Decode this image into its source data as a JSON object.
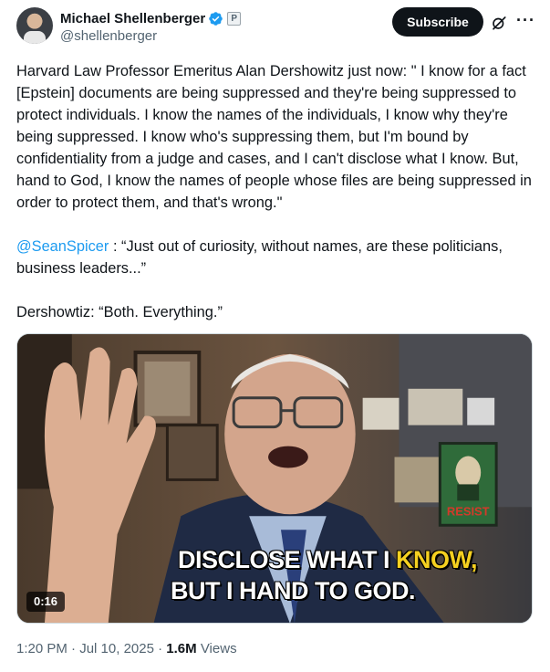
{
  "author": {
    "name": "Michael Shellenberger",
    "handle": "@shellenberger",
    "badge_letter": "P"
  },
  "actions": {
    "subscribe_label": "Subscribe"
  },
  "tweet": {
    "paragraph1": "Harvard Law Professor Emeritus Alan Dershowitz just now: \" I know for a fact [Epstein] documents are being suppressed and they're being suppressed to protect individuals. I know the names of the individuals, I know why they're being suppressed. I know who's suppressing them, but I'm bound by confidentiality from a judge and cases, and I can't disclose what I know. But, hand to God, I know the names of people whose files are being suppressed in order to protect them, and that's wrong.\"",
    "mention": "@SeanSpicer",
    "paragraph2_rest": " : “Just out of curiosity, without names, are these politicians, business leaders...”",
    "paragraph3": "Dershowtiz: “Both. Everything.”"
  },
  "media": {
    "caption_line1_a": "DISCLOSE WHAT I ",
    "caption_line1_b": "KNOW,",
    "caption_line2": "BUT I HAND TO GOD.",
    "duration": "0:16",
    "poster_text": "RESIST"
  },
  "meta": {
    "time": "1:20 PM",
    "sep1": " · ",
    "date": "Jul 10, 2025",
    "sep2": " · ",
    "views": "1.6M",
    "views_label": " Views"
  },
  "colors": {
    "accent": "#1d9bf0",
    "caption_highlight": "#f5d020",
    "text": "#0f1419",
    "muted": "#536471"
  }
}
